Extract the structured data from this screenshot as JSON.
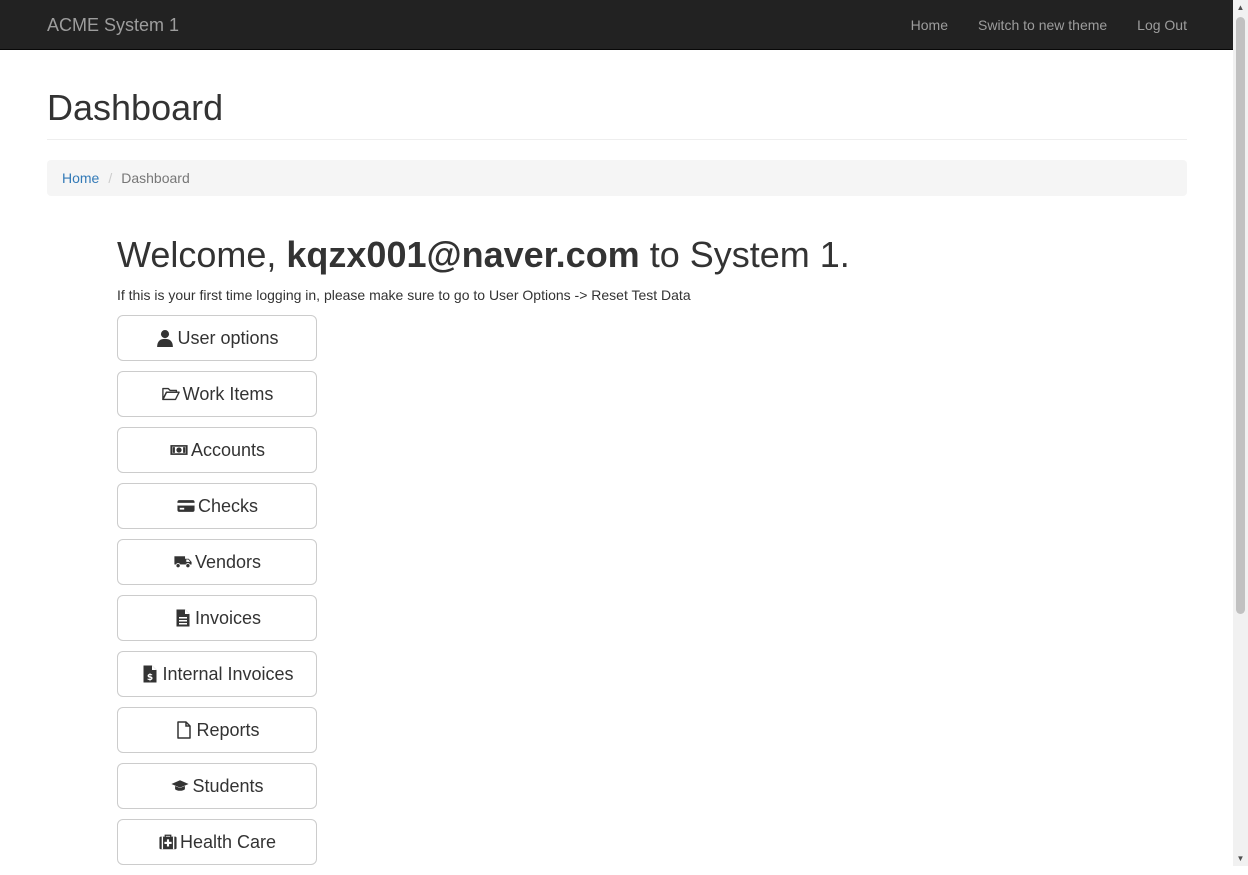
{
  "navbar": {
    "brand": "ACME System 1",
    "links": [
      "Home",
      "Switch to new theme",
      "Log Out"
    ]
  },
  "page": {
    "title": "Dashboard"
  },
  "breadcrumb": {
    "home": "Home",
    "current": "Dashboard"
  },
  "welcome": {
    "prefix": "Welcome, ",
    "email": "kqzx001@naver.com",
    "suffix": " to System 1.",
    "notice": "If this is your first time logging in, please make sure to go to User Options -> Reset Test Data"
  },
  "menu": [
    {
      "label": "User options",
      "icon": "user-icon"
    },
    {
      "label": "Work Items",
      "icon": "folder-open-icon"
    },
    {
      "label": "Accounts",
      "icon": "money-bill-icon"
    },
    {
      "label": "Checks",
      "icon": "credit-card-icon"
    },
    {
      "label": "Vendors",
      "icon": "truck-icon"
    },
    {
      "label": "Invoices",
      "icon": "file-text-icon"
    },
    {
      "label": "Internal Invoices",
      "icon": "file-invoice-dollar-icon"
    },
    {
      "label": "Reports",
      "icon": "file-icon"
    },
    {
      "label": "Students",
      "icon": "graduation-cap-icon"
    },
    {
      "label": "Health Care",
      "icon": "medkit-icon"
    }
  ]
}
